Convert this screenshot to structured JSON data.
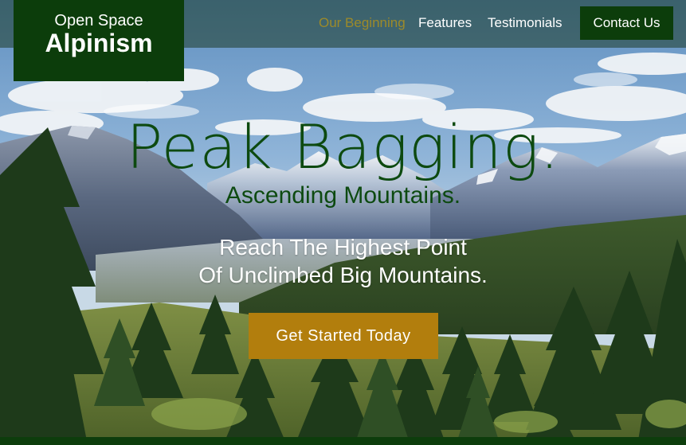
{
  "brand": {
    "line1": "Open Space",
    "line2": "Alpinism",
    "bg_color": "#0c3d0b"
  },
  "nav": {
    "items": [
      {
        "label": "Our Beginning",
        "active": true
      },
      {
        "label": "Features",
        "active": false
      },
      {
        "label": "Testimonials",
        "active": false
      }
    ],
    "contact_label": "Contact Us",
    "active_color": "#9c8a2a"
  },
  "hero": {
    "title": "Peak Bagging.",
    "subtitle": "Ascending Mountains.",
    "tagline_line1": "Reach The Highest Point",
    "tagline_line2": "Of Unclimbed Big Mountains.",
    "cta_label": "Get Started Today",
    "cta_color": "#b27e0d",
    "title_color": "#0d4a10"
  }
}
